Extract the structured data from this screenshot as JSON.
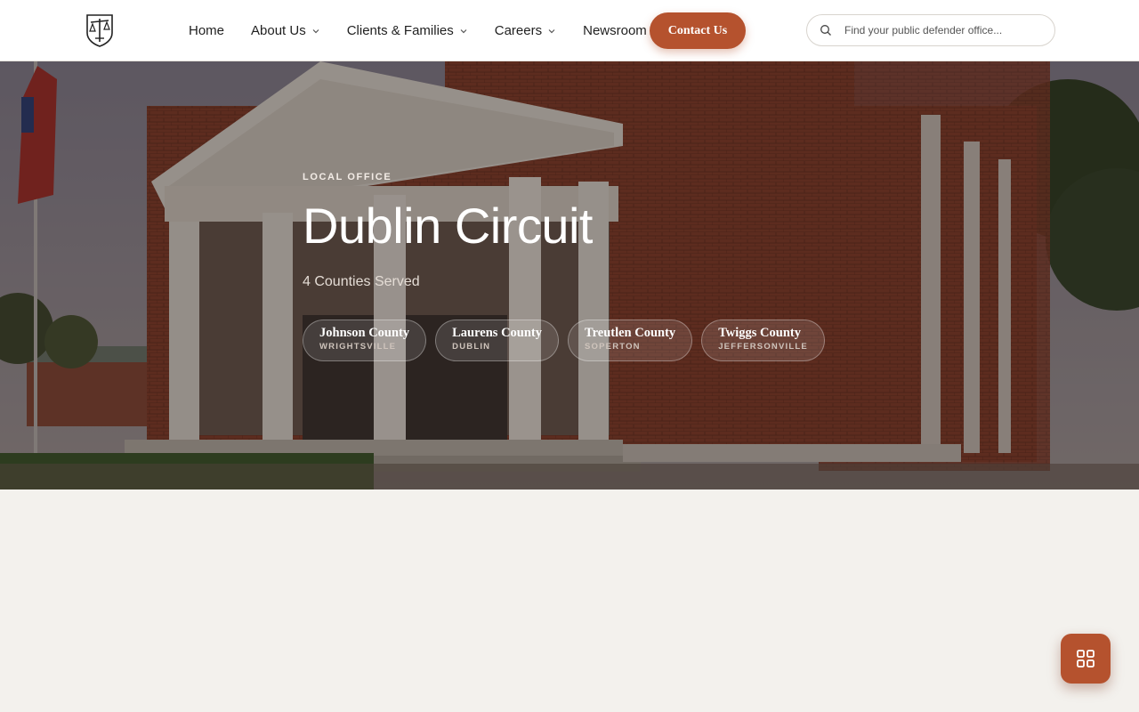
{
  "header": {
    "logo_icon": "scales-of-justice-shield-icon",
    "nav": [
      {
        "label": "Home",
        "has_dropdown": false
      },
      {
        "label": "About Us",
        "has_dropdown": true
      },
      {
        "label": "Clients & Families",
        "has_dropdown": true
      },
      {
        "label": "Careers",
        "has_dropdown": true
      },
      {
        "label": "Newsroom",
        "has_dropdown": false
      }
    ],
    "contact_label": "Contact Us",
    "search_placeholder": "Find your public defender office...",
    "search_value": ""
  },
  "hero": {
    "image_description": "Laurens County Courthouse",
    "eyebrow": "LOCAL OFFICE",
    "title": "Dublin Circuit",
    "subtitle": "4 Counties Served",
    "counties": [
      {
        "name": "Johnson County",
        "city": "WRIGHTSVILLE"
      },
      {
        "name": "Laurens County",
        "city": "DUBLIN"
      },
      {
        "name": "Treutlen County",
        "city": "SOPERTON"
      },
      {
        "name": "Twiggs County",
        "city": "JEFFERSONVILLE"
      }
    ]
  },
  "fab": {
    "icon": "grid-apps-icon"
  },
  "colors": {
    "accent": "#b5522e",
    "page_bg": "#f3f1ed",
    "header_bg": "#ffffff"
  }
}
